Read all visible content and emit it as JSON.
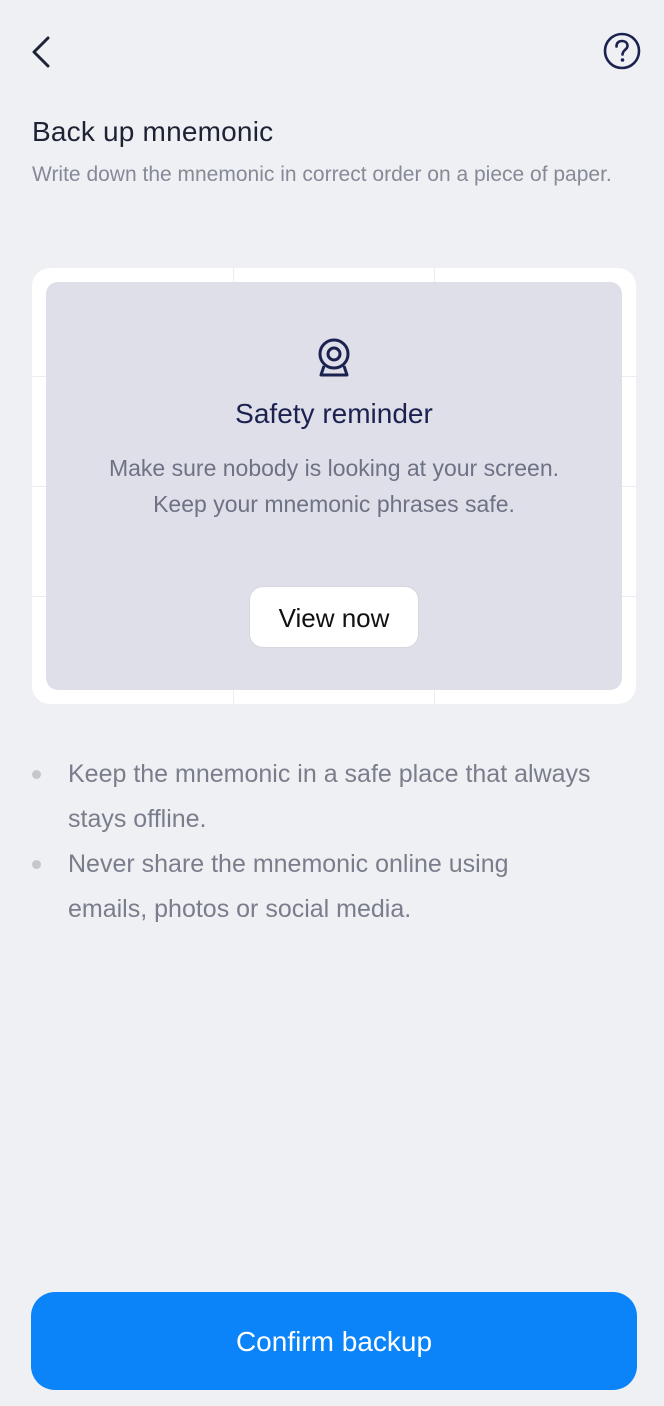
{
  "header": {
    "back_icon": "chevron-left-icon",
    "help_icon": "question-circle-icon"
  },
  "page": {
    "title": "Back up mnemonic",
    "subtitle": "Write down the mnemonic in correct order on a piece of paper."
  },
  "safety_overlay": {
    "icon": "webcam-icon",
    "title": "Safety reminder",
    "message": "Make sure nobody is looking at your screen. Keep your mnemonic phrases safe.",
    "button_label": "View now"
  },
  "tips": [
    {
      "text": "Keep the mnemonic in a safe place that always stays offline."
    },
    {
      "text": "Never share the mnemonic online using emails, photos or social media."
    }
  ],
  "footer": {
    "confirm_label": "Confirm backup"
  },
  "colors": {
    "background": "#eff0f3",
    "primary": "#0a84f8",
    "overlay": "#dfdfe9",
    "title_dark": "#1c2250"
  }
}
